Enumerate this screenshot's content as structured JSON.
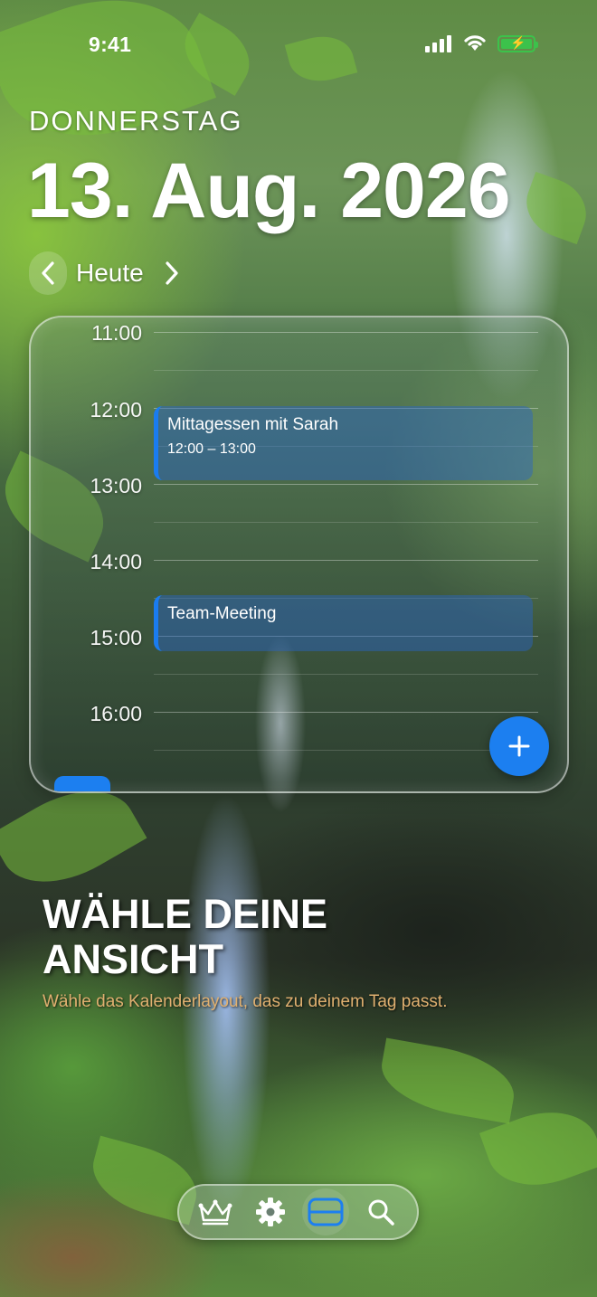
{
  "status_bar": {
    "time": "9:41"
  },
  "header": {
    "weekday": "DONNERSTAG",
    "date": "13. Aug. 2026",
    "today_label": "Heute"
  },
  "calendar": {
    "hours": [
      "11:00",
      "12:00",
      "13:00",
      "14:00",
      "15:00",
      "16:00"
    ],
    "events": [
      {
        "title": "Mittagessen mit Sarah",
        "time": "12:00 – 13:00"
      },
      {
        "title": "Team-Meeting",
        "time": ""
      }
    ],
    "accent_color": "#1c7ff0"
  },
  "promo": {
    "title": "WÄHLE DEINE ANSICHT",
    "subtitle": "Wähle das Kalenderlayout, das zu deinem Tag passt.",
    "subtitle_color": "#e0b070"
  },
  "tab_bar": {
    "items": [
      {
        "icon": "crown-icon",
        "active": false
      },
      {
        "icon": "gear-icon",
        "active": false
      },
      {
        "icon": "calendar-view-icon",
        "active": true
      },
      {
        "icon": "search-icon",
        "active": false
      }
    ]
  }
}
